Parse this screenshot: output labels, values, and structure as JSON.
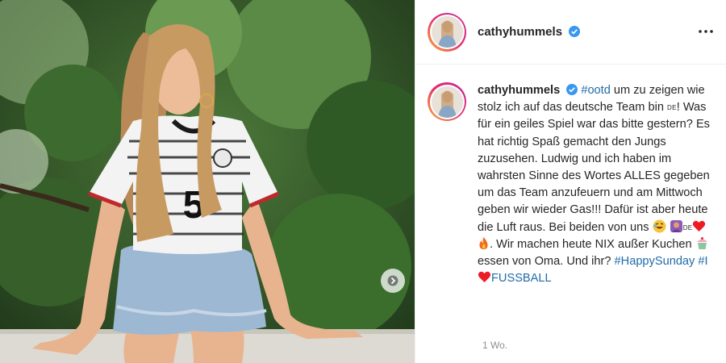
{
  "post": {
    "username": "cathyhummels",
    "verified": true,
    "caption": {
      "username": "cathyhummels",
      "hashtag_ootd": "#ootd",
      "seg1": " um zu zeigen wie stolz ich auf das deutsche Team bin ",
      "flag_de": "DE",
      "seg2": "! Was für ein geiles Spiel war das bitte gestern? Es hat richtig Spaß gemacht den Jungs zuzusehen. Ludwig und ich haben im wahrsten Sinne des Wortes ALLES gegeben um das Team anzufeuern und am Mittwoch geben wir wieder Gas!!! Dafür ist aber heute die Luft raus. Bei beiden von uns ",
      "flag_de2": "DE",
      "seg3": ". Wir machen heute NIX außer Kuchen ",
      "seg4": " essen von Oma. Und ihr?",
      "hashtag_sunday": "#HappySunday",
      "hashtag_fussball_pre": "#I",
      "hashtag_fussball_post": "FUSSBALL"
    },
    "time_ago": "1 Wo.",
    "photo": {
      "jersey_number": "5"
    }
  },
  "icons": [
    "verified-badge-icon",
    "more-options-icon",
    "carousel-next-icon",
    "laughing-emoji-icon",
    "person-emoji-icon",
    "heart-emoji-icon",
    "fire-emoji-icon",
    "cupcake-emoji-icon"
  ],
  "colors": {
    "hashtag": "#1f6ba8",
    "verified": "#3897f0",
    "heart": "#ed1c24"
  }
}
